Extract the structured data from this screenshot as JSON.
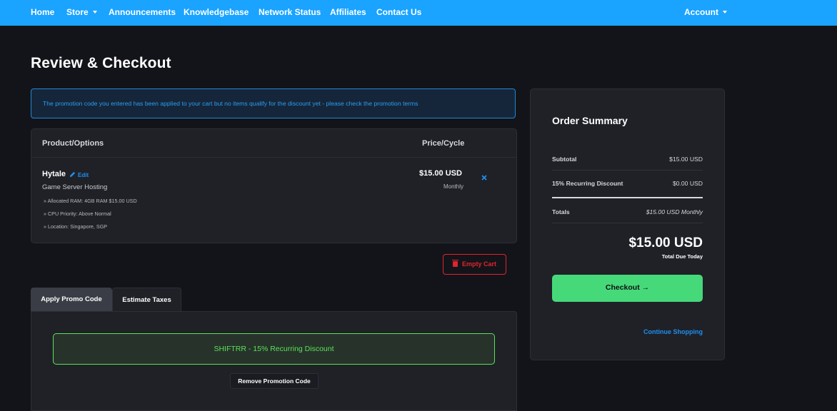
{
  "nav": {
    "home": "Home",
    "store": "Store",
    "announcements": "Announcements",
    "knowledgebase": "Knowledgebase",
    "network_status": "Network Status",
    "affiliates": "Affiliates",
    "contact_us": "Contact Us",
    "account": "Account"
  },
  "page_title": "Review & Checkout",
  "alert": "The promotion code you entered has been applied to your cart but no items qualify for the discount yet - please check the promotion terms",
  "cart": {
    "header_product": "Product/Options",
    "header_price": "Price/Cycle",
    "item": {
      "name": "Hytale",
      "edit": "Edit",
      "group": "Game Server Hosting",
      "options": [
        "» Allocated RAM: 4GB RAM $15.00 USD",
        "» CPU Priority: Above Normal",
        "» Location: Singapore, SGP"
      ],
      "price": "$15.00 USD",
      "cycle": "Monthly"
    },
    "empty_cart": "Empty Cart"
  },
  "tabs": {
    "promo": "Apply Promo Code",
    "taxes": "Estimate Taxes"
  },
  "promo": {
    "applied": "SHIFTRR - 15% Recurring Discount",
    "remove": "Remove Promotion Code"
  },
  "summary": {
    "title": "Order Summary",
    "subtotal_label": "Subtotal",
    "subtotal_value": "$15.00 USD",
    "discount_label": "15% Recurring Discount",
    "discount_value": "$0.00 USD",
    "totals_label": "Totals",
    "totals_value": "$15.00 USD Monthly",
    "total_due": "$15.00 USD",
    "total_due_label": "Total Due Today",
    "checkout": "Checkout",
    "checkout_arrow": "→",
    "continue": "Continue Shopping"
  },
  "colors": {
    "nav_bg": "#1aa3ff",
    "page_bg": "#131419",
    "accent_blue": "#1e8ff0",
    "success_green": "#5ce05a",
    "checkout_green": "#46d97a",
    "danger_red": "#e0242d"
  }
}
